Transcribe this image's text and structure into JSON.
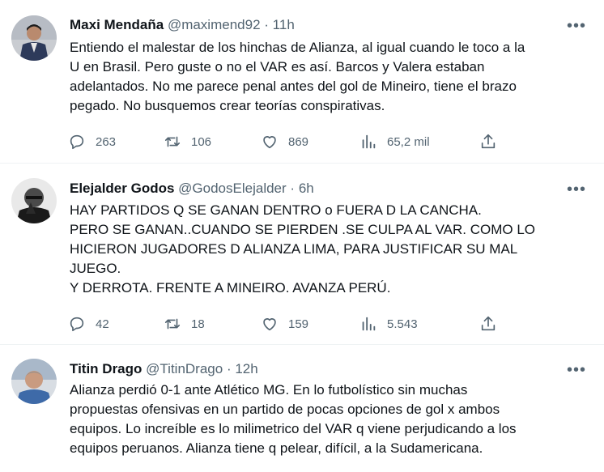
{
  "tweets": [
    {
      "name": "Maxi Mendaña",
      "handle": "@maximend92",
      "dot": "·",
      "time": "11h",
      "more": "•••",
      "lines": [
        "Entiendo el malestar de los hinchas de Alianza, al igual cuando le toco a la",
        "U en Brasil. Pero guste o no el VAR es así. Barcos y Valera estaban",
        "adelantados. No me parece penal antes del gol de Mineiro, tiene el brazo",
        "pegado. No busquemos crear teorías conspirativas."
      ],
      "replies": "263",
      "retweets": "106",
      "likes": "869",
      "views": "65,2 mil"
    },
    {
      "name": "Elejalder Godos",
      "handle": "@GodosElejalder",
      "dot": "·",
      "time": "6h",
      "more": "•••",
      "lines": [
        "HAY PARTIDOS Q SE GANAN DENTRO o FUERA D LA CANCHA.",
        "PERO SE GANAN..CUANDO SE PIERDEN .SE CULPA AL  VAR. COMO LO",
        "HICIERON JUGADORES D ALIANZA LIMA, PARA JUSTIFICAR SU MAL",
        "JUEGO.",
        "Y DERROTA. FRENTE A MINEIRO.  AVANZA PERÚ."
      ],
      "replies": "42",
      "retweets": "18",
      "likes": "159",
      "views": "5.543"
    },
    {
      "name": "Titin Drago",
      "handle": "@TitinDrago",
      "dot": "·",
      "time": "12h",
      "more": "•••",
      "lines": [
        "Alianza perdió 0-1 ante Atlético MG. En lo futbolístico sin muchas",
        "propuestas ofensivas en un partido de pocas opciones de gol x ambos",
        "equipos. Lo increíble es lo milimetrico del VAR q viene perjudicando a los",
        "equipos peruanos. Alianza tiene q pelear, difícil, a la Sudamericana."
      ]
    }
  ]
}
